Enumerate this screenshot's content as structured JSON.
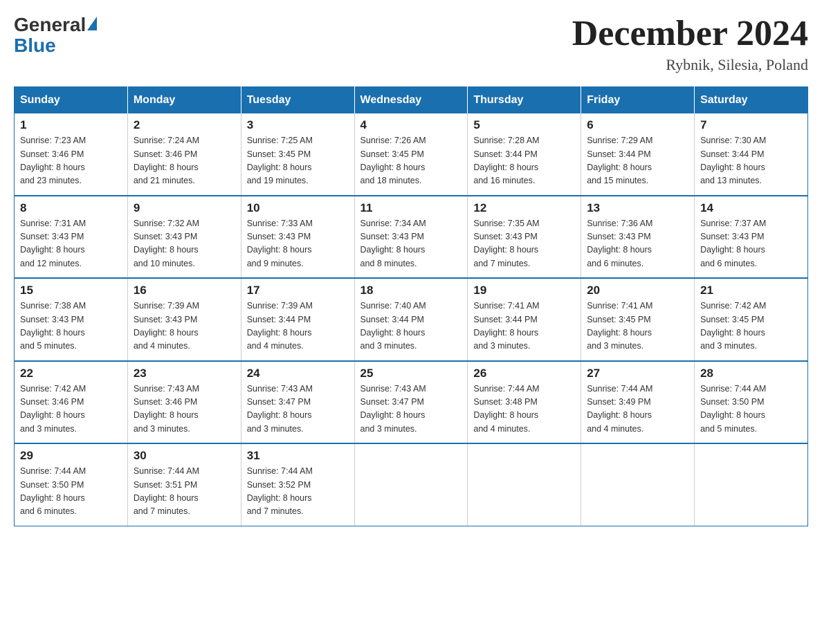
{
  "header": {
    "logo_general": "General",
    "logo_blue": "Blue",
    "month_title": "December 2024",
    "location": "Rybnik, Silesia, Poland"
  },
  "calendar": {
    "days_of_week": [
      "Sunday",
      "Monday",
      "Tuesday",
      "Wednesday",
      "Thursday",
      "Friday",
      "Saturday"
    ],
    "weeks": [
      [
        {
          "day": "1",
          "sunrise": "7:23 AM",
          "sunset": "3:46 PM",
          "daylight": "8 hours and 23 minutes."
        },
        {
          "day": "2",
          "sunrise": "7:24 AM",
          "sunset": "3:46 PM",
          "daylight": "8 hours and 21 minutes."
        },
        {
          "day": "3",
          "sunrise": "7:25 AM",
          "sunset": "3:45 PM",
          "daylight": "8 hours and 19 minutes."
        },
        {
          "day": "4",
          "sunrise": "7:26 AM",
          "sunset": "3:45 PM",
          "daylight": "8 hours and 18 minutes."
        },
        {
          "day": "5",
          "sunrise": "7:28 AM",
          "sunset": "3:44 PM",
          "daylight": "8 hours and 16 minutes."
        },
        {
          "day": "6",
          "sunrise": "7:29 AM",
          "sunset": "3:44 PM",
          "daylight": "8 hours and 15 minutes."
        },
        {
          "day": "7",
          "sunrise": "7:30 AM",
          "sunset": "3:44 PM",
          "daylight": "8 hours and 13 minutes."
        }
      ],
      [
        {
          "day": "8",
          "sunrise": "7:31 AM",
          "sunset": "3:43 PM",
          "daylight": "8 hours and 12 minutes."
        },
        {
          "day": "9",
          "sunrise": "7:32 AM",
          "sunset": "3:43 PM",
          "daylight": "8 hours and 10 minutes."
        },
        {
          "day": "10",
          "sunrise": "7:33 AM",
          "sunset": "3:43 PM",
          "daylight": "8 hours and 9 minutes."
        },
        {
          "day": "11",
          "sunrise": "7:34 AM",
          "sunset": "3:43 PM",
          "daylight": "8 hours and 8 minutes."
        },
        {
          "day": "12",
          "sunrise": "7:35 AM",
          "sunset": "3:43 PM",
          "daylight": "8 hours and 7 minutes."
        },
        {
          "day": "13",
          "sunrise": "7:36 AM",
          "sunset": "3:43 PM",
          "daylight": "8 hours and 6 minutes."
        },
        {
          "day": "14",
          "sunrise": "7:37 AM",
          "sunset": "3:43 PM",
          "daylight": "8 hours and 6 minutes."
        }
      ],
      [
        {
          "day": "15",
          "sunrise": "7:38 AM",
          "sunset": "3:43 PM",
          "daylight": "8 hours and 5 minutes."
        },
        {
          "day": "16",
          "sunrise": "7:39 AM",
          "sunset": "3:43 PM",
          "daylight": "8 hours and 4 minutes."
        },
        {
          "day": "17",
          "sunrise": "7:39 AM",
          "sunset": "3:44 PM",
          "daylight": "8 hours and 4 minutes."
        },
        {
          "day": "18",
          "sunrise": "7:40 AM",
          "sunset": "3:44 PM",
          "daylight": "8 hours and 3 minutes."
        },
        {
          "day": "19",
          "sunrise": "7:41 AM",
          "sunset": "3:44 PM",
          "daylight": "8 hours and 3 minutes."
        },
        {
          "day": "20",
          "sunrise": "7:41 AM",
          "sunset": "3:45 PM",
          "daylight": "8 hours and 3 minutes."
        },
        {
          "day": "21",
          "sunrise": "7:42 AM",
          "sunset": "3:45 PM",
          "daylight": "8 hours and 3 minutes."
        }
      ],
      [
        {
          "day": "22",
          "sunrise": "7:42 AM",
          "sunset": "3:46 PM",
          "daylight": "8 hours and 3 minutes."
        },
        {
          "day": "23",
          "sunrise": "7:43 AM",
          "sunset": "3:46 PM",
          "daylight": "8 hours and 3 minutes."
        },
        {
          "day": "24",
          "sunrise": "7:43 AM",
          "sunset": "3:47 PM",
          "daylight": "8 hours and 3 minutes."
        },
        {
          "day": "25",
          "sunrise": "7:43 AM",
          "sunset": "3:47 PM",
          "daylight": "8 hours and 3 minutes."
        },
        {
          "day": "26",
          "sunrise": "7:44 AM",
          "sunset": "3:48 PM",
          "daylight": "8 hours and 4 minutes."
        },
        {
          "day": "27",
          "sunrise": "7:44 AM",
          "sunset": "3:49 PM",
          "daylight": "8 hours and 4 minutes."
        },
        {
          "day": "28",
          "sunrise": "7:44 AM",
          "sunset": "3:50 PM",
          "daylight": "8 hours and 5 minutes."
        }
      ],
      [
        {
          "day": "29",
          "sunrise": "7:44 AM",
          "sunset": "3:50 PM",
          "daylight": "8 hours and 6 minutes."
        },
        {
          "day": "30",
          "sunrise": "7:44 AM",
          "sunset": "3:51 PM",
          "daylight": "8 hours and 7 minutes."
        },
        {
          "day": "31",
          "sunrise": "7:44 AM",
          "sunset": "3:52 PM",
          "daylight": "8 hours and 7 minutes."
        },
        null,
        null,
        null,
        null
      ]
    ],
    "sunrise_label": "Sunrise:",
    "sunset_label": "Sunset:",
    "daylight_label": "Daylight:"
  }
}
